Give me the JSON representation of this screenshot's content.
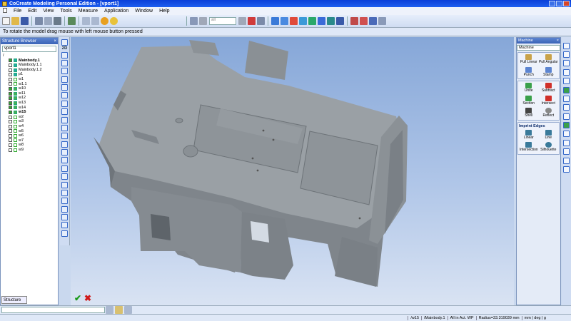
{
  "window": {
    "title": "CoCreate Modeling Personal Edition - [vport1]"
  },
  "menu": [
    "File",
    "Edit",
    "View",
    "Tools",
    "Measure",
    "Application",
    "Window",
    "Help"
  ],
  "toolbar": {
    "combo_value": "all"
  },
  "hint": "To rotate the model drag mouse with left mouse button pressed",
  "structure_browser": {
    "title": "Structure Browser",
    "selected": "vport1",
    "items": [
      {
        "label": "/",
        "bold": false
      },
      {
        "label": "Mainbody.1",
        "bold": true
      },
      {
        "label": "Mainbody.1.1",
        "bold": false
      },
      {
        "label": "Mainbody.1.2",
        "bold": false
      },
      {
        "label": "p1",
        "bold": false
      },
      {
        "label": "w1",
        "bold": false
      },
      {
        "label": "w1.1",
        "bold": false
      },
      {
        "label": "w10",
        "bold": false
      },
      {
        "label": "w11",
        "bold": false
      },
      {
        "label": "w12",
        "bold": false
      },
      {
        "label": "w13",
        "bold": false
      },
      {
        "label": "w14",
        "bold": false
      },
      {
        "label": "w15",
        "bold": true
      },
      {
        "label": "w2",
        "bold": false
      },
      {
        "label": "w3",
        "bold": false
      },
      {
        "label": "w4",
        "bold": false
      },
      {
        "label": "w5",
        "bold": false
      },
      {
        "label": "w6",
        "bold": false
      },
      {
        "label": "w7",
        "bold": false
      },
      {
        "label": "w8",
        "bold": false
      },
      {
        "label": "w9",
        "bold": false
      }
    ],
    "tab": "Structure"
  },
  "left_tools_2d": "2D",
  "right_panel": {
    "header": "Machine",
    "combo": "Machine",
    "machine_group": [
      {
        "label": "Pull Linear",
        "icon": "pull-linear-icon",
        "color": "#c8a24a"
      },
      {
        "label": "Pull Angular",
        "icon": "pull-angular-icon",
        "color": "#c8a24a"
      },
      {
        "label": "Punch",
        "icon": "punch-icon",
        "color": "#5c84d0"
      },
      {
        "label": "Stamp",
        "icon": "stamp-icon",
        "color": "#5c84d0"
      }
    ],
    "boolean_group": [
      {
        "label": "Unite",
        "icon": "unite-icon",
        "color": "#3aa04a"
      },
      {
        "label": "Subtract",
        "icon": "subtract-icon",
        "color": "#d0302a"
      },
      {
        "label": "Section",
        "icon": "section-icon",
        "color": "#3aa04a"
      },
      {
        "label": "Intersect",
        "icon": "intersect-icon",
        "color": "#d0302a"
      },
      {
        "label": "Shell",
        "icon": "shell-icon",
        "color": "#444444"
      },
      {
        "label": "Reflect",
        "icon": "reflect-icon",
        "color": "#888888"
      }
    ],
    "imprint_title": "Imprint Edges",
    "imprint_group": [
      {
        "label": "Linear",
        "icon": "imprint-linear-icon",
        "color": "#3a7a9a"
      },
      {
        "label": "Line",
        "icon": "imprint-line-icon",
        "color": "#3a7a9a"
      },
      {
        "label": "Intersection",
        "icon": "imprint-intersection-icon",
        "color": "#3a7a9a"
      },
      {
        "label": "Silhouette",
        "icon": "silhouette-icon",
        "color": "#3a7a9a"
      }
    ]
  },
  "status": [
    "/w15",
    "/Mainbody.1",
    "All in Act. WP",
    "Radius=33.319039 mm",
    "mm | deg | g"
  ],
  "colors": {
    "model_face": "#8e9399",
    "model_top": "#9ca1a6",
    "model_dark": "#6c7178",
    "background_top": "#86a7d8"
  }
}
